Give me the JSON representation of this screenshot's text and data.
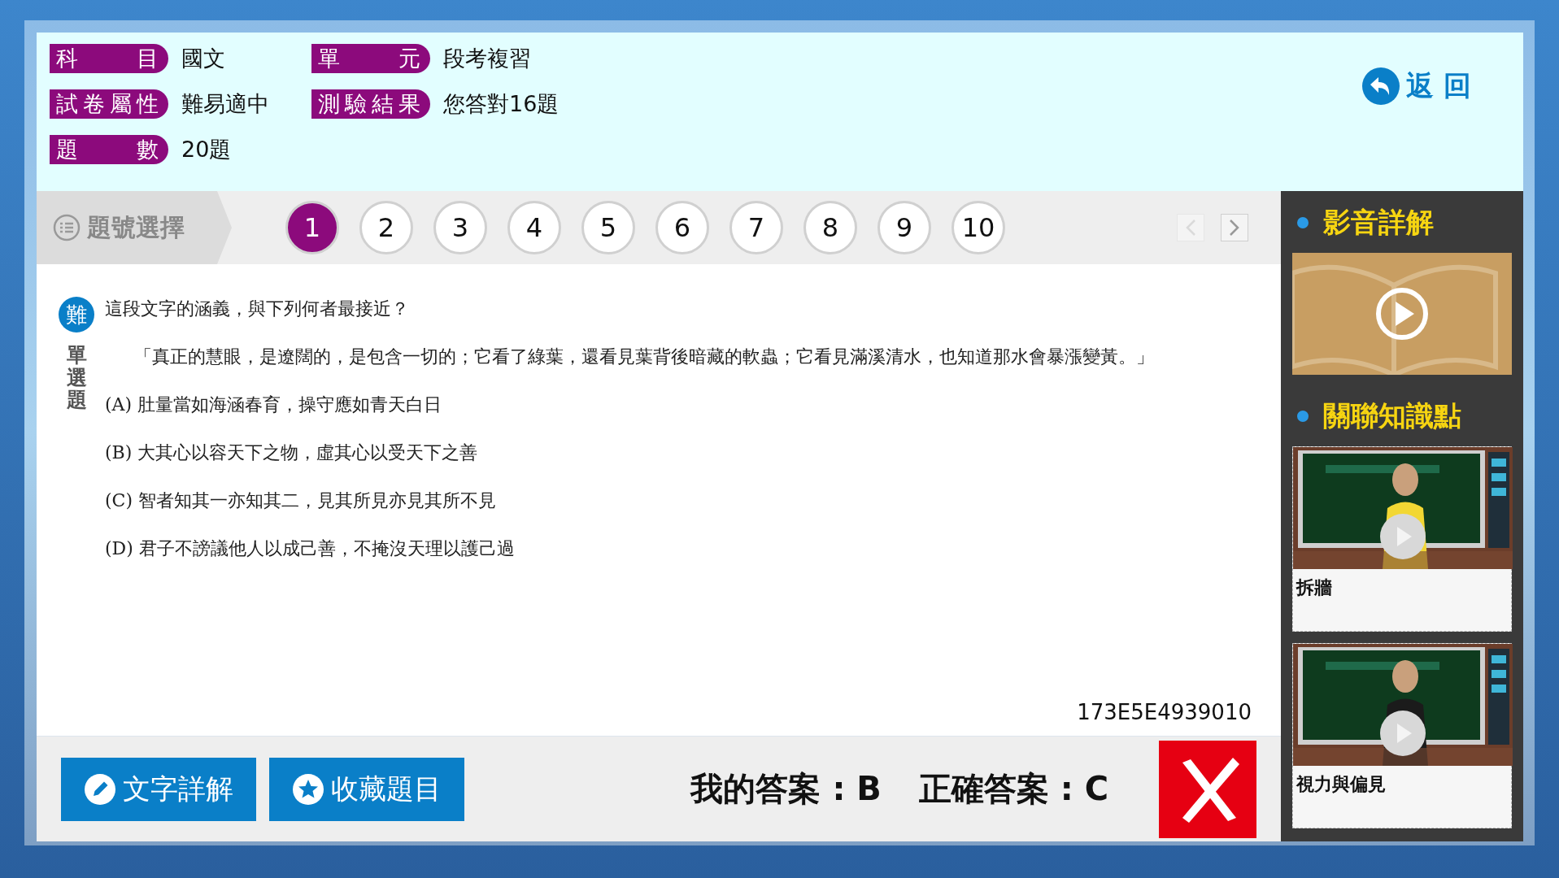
{
  "header": {
    "fields": [
      {
        "label": "科目",
        "value": "國文"
      },
      {
        "label": "單元",
        "value": "段考複習"
      },
      {
        "label": "試卷屬性",
        "value": "難易適中"
      },
      {
        "label": "測驗結果",
        "value": "您答對16題"
      },
      {
        "label": "題數",
        "value": "20題"
      }
    ],
    "back_button": "返回"
  },
  "question_nav": {
    "label": "題號選擇",
    "numbers": [
      {
        "label": "1",
        "selected": true
      },
      {
        "label": "2",
        "selected": false
      },
      {
        "label": "3",
        "selected": false
      },
      {
        "label": "4",
        "selected": false
      },
      {
        "label": "5",
        "selected": false
      },
      {
        "label": "6",
        "selected": false
      },
      {
        "label": "7",
        "selected": false
      },
      {
        "label": "8",
        "selected": false
      },
      {
        "label": "9",
        "selected": false
      },
      {
        "label": "10",
        "selected": false
      }
    ],
    "prev": {
      "disabled": true
    },
    "next": {
      "disabled": false
    }
  },
  "question": {
    "difficulty": "難",
    "type": "單選題",
    "prompt": "這段文字的涵義，與下列何者最接近？",
    "passage": "「真正的慧眼，是遼闊的，是包含一切的；它看了綠葉，還看見葉背後暗藏的軟蟲；它看見滿溪清水，也知道那水會暴漲變黃。」",
    "options": [
      {
        "label": "(A)",
        "text": "肚量當如海涵春育，操守應如青天白日"
      },
      {
        "label": "(B)",
        "text": "大其心以容天下之物，虛其心以受天下之善"
      },
      {
        "label": "(C)",
        "text": "智者知其一亦知其二，見其所見亦見其所不見"
      },
      {
        "label": "(D)",
        "text": "君子不謗議他人以成己善，不掩沒天理以護己過"
      }
    ],
    "code": "173E5E4939010"
  },
  "bottom": {
    "buttons": [
      {
        "label": "文字詳解",
        "kind": "pencil"
      },
      {
        "label": "收藏題目",
        "kind": "star"
      }
    ],
    "my_answer": "我的答案 : B",
    "correct_answer": "正確答案 : C",
    "correct": false
  },
  "side": {
    "video_title": "影音詳解",
    "related_title": "關聯知識點",
    "related": [
      {
        "caption": "拆牆"
      },
      {
        "caption": "視力與偏見"
      }
    ]
  }
}
